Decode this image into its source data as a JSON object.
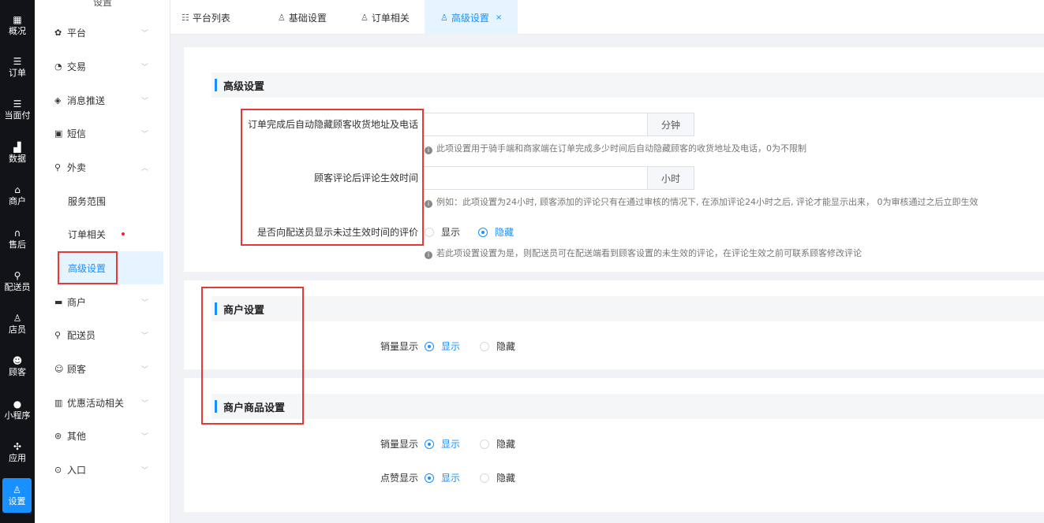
{
  "left_nav": [
    {
      "icon": "grid-icon",
      "glyph": "▦",
      "label": "概况"
    },
    {
      "icon": "list-icon",
      "glyph": "☰",
      "label": "订单"
    },
    {
      "icon": "list-icon",
      "glyph": "☰",
      "label": "当面付"
    },
    {
      "icon": "bar-chart-icon",
      "glyph": "▟",
      "label": "数据"
    },
    {
      "icon": "shop-icon",
      "glyph": "⌂",
      "label": "商户"
    },
    {
      "icon": "headset-icon",
      "glyph": "∩",
      "label": "售后"
    },
    {
      "icon": "bike-icon",
      "glyph": "⚲",
      "label": "配送员"
    },
    {
      "icon": "user-icon",
      "glyph": "♙",
      "label": "店员"
    },
    {
      "icon": "customer-icon",
      "glyph": "☻",
      "label": "顾客"
    },
    {
      "icon": "wechat-icon",
      "glyph": "●",
      "label": "小程序"
    },
    {
      "icon": "apps-icon",
      "glyph": "✣",
      "label": "应用"
    },
    {
      "icon": "settings-user-icon",
      "glyph": "♙",
      "label": "设置"
    }
  ],
  "submenu": {
    "title": "设置",
    "items": [
      {
        "icon": "gear-icon",
        "glyph": "✿",
        "label": "平台",
        "chev": "﹀"
      },
      {
        "icon": "trade-icon",
        "glyph": "◔",
        "label": "交易",
        "chev": "﹀"
      },
      {
        "icon": "message-icon",
        "glyph": "◈",
        "label": "消息推送",
        "chev": "﹀"
      },
      {
        "icon": "sms-icon",
        "glyph": "▣",
        "label": "短信",
        "chev": "﹀"
      },
      {
        "icon": "takeout-icon",
        "glyph": "⚲",
        "label": "外卖",
        "chev": "︿"
      }
    ],
    "sub_items": [
      {
        "label": "服务范围"
      },
      {
        "label": "订单相关"
      },
      {
        "label": "高级设置"
      }
    ],
    "items_after": [
      {
        "icon": "shop-icon",
        "glyph": "▬",
        "label": "商户",
        "chev": "﹀"
      },
      {
        "icon": "bike-icon",
        "glyph": "⚲",
        "label": "配送员",
        "chev": "﹀"
      },
      {
        "icon": "customer-icon",
        "glyph": "☺",
        "label": "顾客",
        "chev": "﹀"
      },
      {
        "icon": "gift-icon",
        "glyph": "▥",
        "label": "优惠活动相关",
        "chev": "﹀"
      },
      {
        "icon": "other-icon",
        "glyph": "⊚",
        "label": "其他",
        "chev": "﹀"
      },
      {
        "icon": "entry-icon",
        "glyph": "⊙",
        "label": "入口",
        "chev": "﹀"
      }
    ]
  },
  "tabs": [
    {
      "icon": "list-icon",
      "glyph": "☷",
      "label": "平台列表"
    },
    {
      "icon": "user-gear-icon",
      "glyph": "♙",
      "label": "基础设置"
    },
    {
      "icon": "user-gear-icon",
      "glyph": "♙",
      "label": "订单相关"
    },
    {
      "icon": "user-gear-icon",
      "glyph": "♙",
      "label": "高级设置",
      "close": "×"
    }
  ],
  "advanced": {
    "title": "高级设置",
    "hide_address_label": "订单完成后自动隐藏顾客收货地址及电话",
    "hide_address_value": "",
    "hide_address_unit": "分钟",
    "hide_address_hint": "此项设置用于骑手端和商家端在订单完成多少时间后自动隐藏顾客的收货地址及电话，0为不限制",
    "review_effect_label": "顾客评论后评论生效时间",
    "review_effect_value": "",
    "review_effect_unit": "小时",
    "review_effect_hint": "例如：此项设置为24小时, 顾客添加的评论只有在通过审核的情况下, 在添加评论24小时之后, 评论才能显示出来， 0为审核通过之后立即生效",
    "show_pending_label": "是否向配送员显示未过生效时间的评价",
    "show_option": "显示",
    "hide_option": "隐藏",
    "show_pending_selected": "隐藏",
    "show_pending_hint": "若此项设置设置为是，则配送员可在配送端看到顾客设置的未生效的评论，在评论生效之前可联系顾客修改评论"
  },
  "merchant": {
    "title": "商户设置",
    "sales_label": "销量显示",
    "show_option": "显示",
    "hide_option": "隐藏",
    "sales_selected": "显示"
  },
  "merchant_goods": {
    "title": "商户商品设置",
    "sales_label": "销量显示",
    "likes_label": "点赞显示",
    "show_option": "显示",
    "hide_option": "隐藏",
    "sales_selected": "显示",
    "likes_selected": "显示"
  },
  "colors": {
    "accent": "#1890ff",
    "highlight_box": "#e53935",
    "nav_bg": "#111317"
  }
}
